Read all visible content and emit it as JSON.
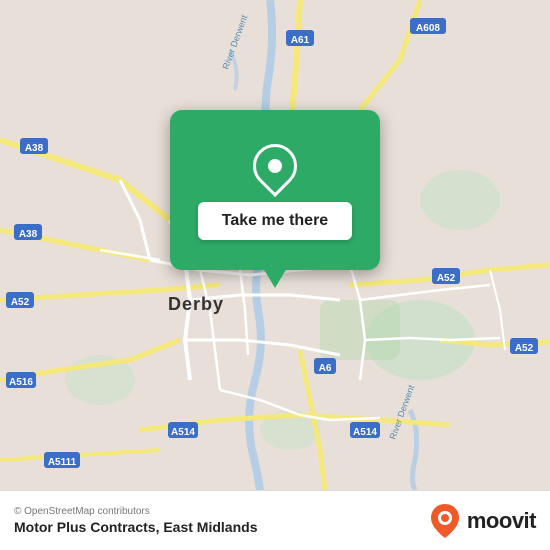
{
  "map": {
    "region": "Derby, East Midlands",
    "background_color": "#e8e0d8"
  },
  "popup": {
    "button_label": "Take me there",
    "icon_type": "location-pin"
  },
  "footer": {
    "copyright": "© OpenStreetMap contributors",
    "location_name": "Motor Plus Contracts, East Midlands",
    "logo_text": "moovit"
  }
}
